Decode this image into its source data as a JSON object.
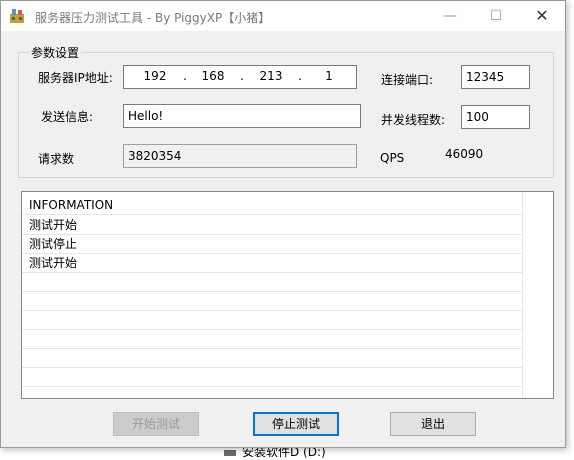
{
  "titlebar": {
    "title": "服务器压力测试工具 - By PiggyXP【小猪】",
    "min_glyph": "—",
    "max_glyph": "☐",
    "close_glyph": "✕"
  },
  "params": {
    "group_title": "参数设置",
    "server_ip_label": "服务器IP地址:",
    "server_ip": [
      "192",
      "168",
      "213",
      "1"
    ],
    "ip_dot": ".",
    "port_label": "连接端口:",
    "port_value": "12345",
    "message_label": "发送信息:",
    "message_value": "Hello!",
    "threads_label": "并发线程数:",
    "threads_value": "100",
    "requests_label": "请求数",
    "requests_value": "3820354",
    "qps_label": "QPS",
    "qps_value": "46090"
  },
  "log": {
    "items": [
      "INFORMATION",
      "测试开始",
      "测试停止",
      "测试开始"
    ]
  },
  "buttons": {
    "start": "开始测试",
    "stop": "停止测试",
    "exit": "退出"
  },
  "background": {
    "drive_label": "安装软件D (D:)"
  },
  "colors": {
    "window_bg": "#f0f0f0",
    "focus_border": "#0078d7",
    "title_text": "#7a7a7a"
  }
}
